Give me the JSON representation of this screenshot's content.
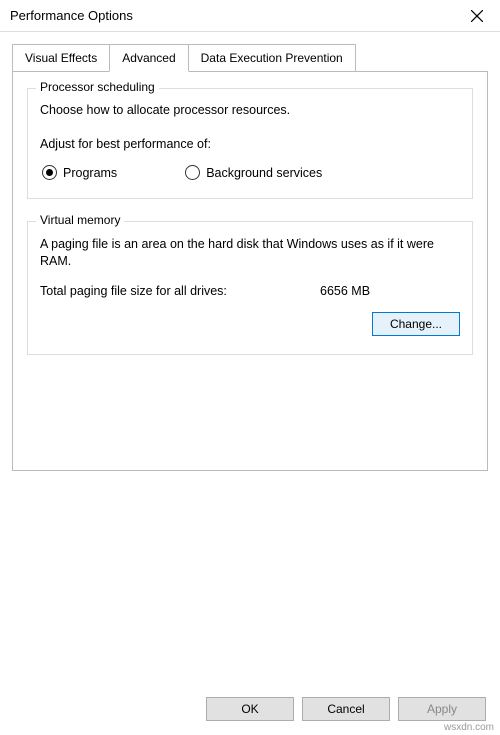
{
  "window": {
    "title": "Performance Options"
  },
  "tabs": {
    "visual_effects": "Visual Effects",
    "advanced": "Advanced",
    "dep": "Data Execution Prevention"
  },
  "processor_group": {
    "title": "Processor scheduling",
    "description": "Choose how to allocate processor resources.",
    "adjust_label": "Adjust for best performance of:",
    "option_programs": "Programs",
    "option_background": "Background services",
    "selected": "programs"
  },
  "vm_group": {
    "title": "Virtual memory",
    "description": "A paging file is an area on the hard disk that Windows uses as if it were RAM.",
    "total_label": "Total paging file size for all drives:",
    "total_value": "6656 MB",
    "change_label": "Change..."
  },
  "buttons": {
    "ok": "OK",
    "cancel": "Cancel",
    "apply": "Apply"
  },
  "watermark": "wsxdn.com"
}
